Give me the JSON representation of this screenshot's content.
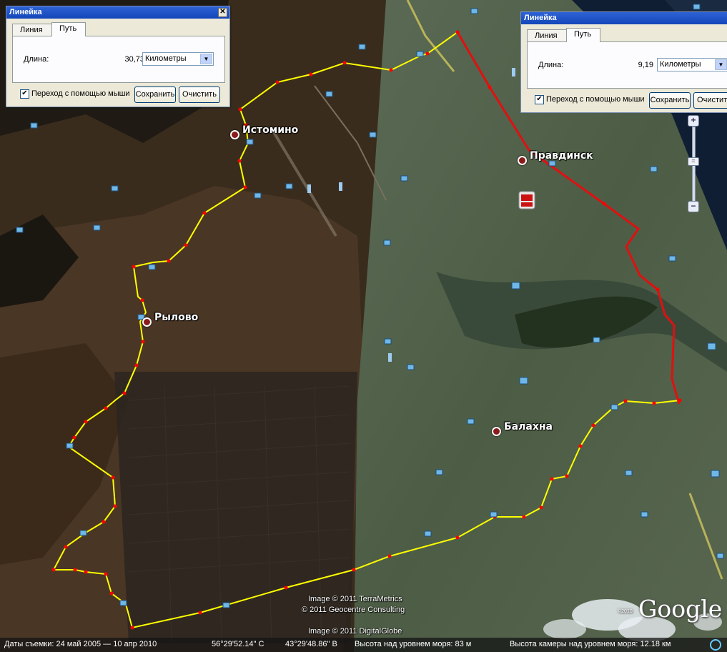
{
  "ruler_left": {
    "title": "Линейка",
    "close_glyph": "✕",
    "tabs": [
      "Линия",
      "Путь"
    ],
    "active_tab": "Путь",
    "length_label": "Длина:",
    "length_value": "30,73",
    "unit": "Километры",
    "mouse_nav_label": "Переход с помощью мыши",
    "mouse_nav_checked": true,
    "save_label": "Сохранить",
    "clear_label": "Очистить"
  },
  "ruler_right": {
    "title": "Линейка",
    "tabs": [
      "Линия",
      "Путь"
    ],
    "active_tab": "Путь",
    "length_label": "Длина:",
    "length_value": "9,19",
    "unit": "Километры",
    "mouse_nav_label": "Переход с помощью мыши",
    "mouse_nav_checked": true,
    "save_label": "Сохранить",
    "clear_label": "Очистить"
  },
  "places": [
    {
      "name": "Истомино"
    },
    {
      "name": "Рылово"
    },
    {
      "name": "Правдинск"
    },
    {
      "name": "Балахна"
    }
  ],
  "copyrights": {
    "terrametrics": "Image © 2011 TerraMetrics",
    "geocentre": "© 2011 Geocentre Consulting",
    "digitalglobe": "Image © 2011 DigitalGlobe"
  },
  "logo": {
    "text": "Google",
    "small": "©2010"
  },
  "statusbar": {
    "imagery_dates": "Даты съемки: 24 май 2005 — 10 апр 2010",
    "lat": "56°29'52.14\" С",
    "lon": "43°29'48.86\" В",
    "elevation": "Высота над уровнем моря:   83 м",
    "eye_alt": "Высота камеры над уровнем моря:   12.18 км"
  },
  "zoom": {
    "plus": "+",
    "minus": "−",
    "thumb": "="
  },
  "colors": {
    "path_yellow": "#ffff00",
    "path_red": "#e01010",
    "vertex": "#ff0000",
    "water": "#0f1e33"
  },
  "icons": [
    "photo-marker-icon",
    "wiki-marker-icon",
    "youtube-icon",
    "close-icon",
    "chevron-down-icon"
  ]
}
